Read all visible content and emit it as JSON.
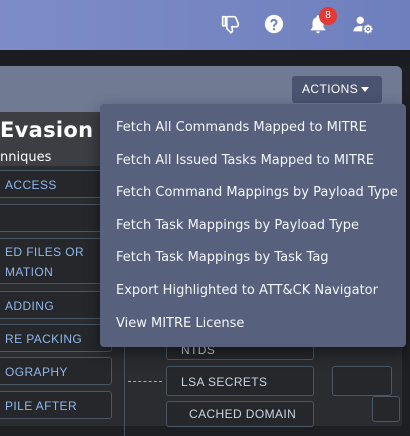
{
  "topbar": {
    "icons": [
      "thumbs-down-icon",
      "help-circle-icon",
      "bell-icon",
      "user-settings-icon"
    ],
    "notification_count": "8",
    "colors": {
      "bar": "#7585c2",
      "badge": "#e53935"
    }
  },
  "panel": {
    "actions_label": "ACTIONS",
    "tactic_title": "Evasion",
    "tactic_subtitle": "nniques"
  },
  "techniques": [
    {
      "lines": [
        "ACCESS"
      ]
    },
    {
      "lines": [
        ""
      ]
    },
    {
      "lines": [
        "ED FILES OR",
        "MATION"
      ]
    },
    {
      "lines": [
        "ADDING"
      ]
    },
    {
      "lines": [
        "RE PACKING"
      ]
    },
    {
      "lines": [
        "OGRAPHY"
      ]
    },
    {
      "lines": [
        "PILE AFTER"
      ]
    }
  ],
  "subtechniques": {
    "ntds": "NTDS",
    "lsa_secrets": "LSA SECRETS",
    "cached_domain": "CACHED DOMAIN"
  },
  "actions_menu": {
    "items": [
      "Fetch All Commands Mapped to MITRE",
      "Fetch All Issued Tasks Mapped to MITRE",
      "Fetch Command Mappings by Payload Type",
      "Fetch Task Mappings by Payload Type",
      "Fetch Task Mappings by Task Tag",
      "Export Highlighted to ATT&CK Navigator",
      "View MITRE License"
    ]
  }
}
